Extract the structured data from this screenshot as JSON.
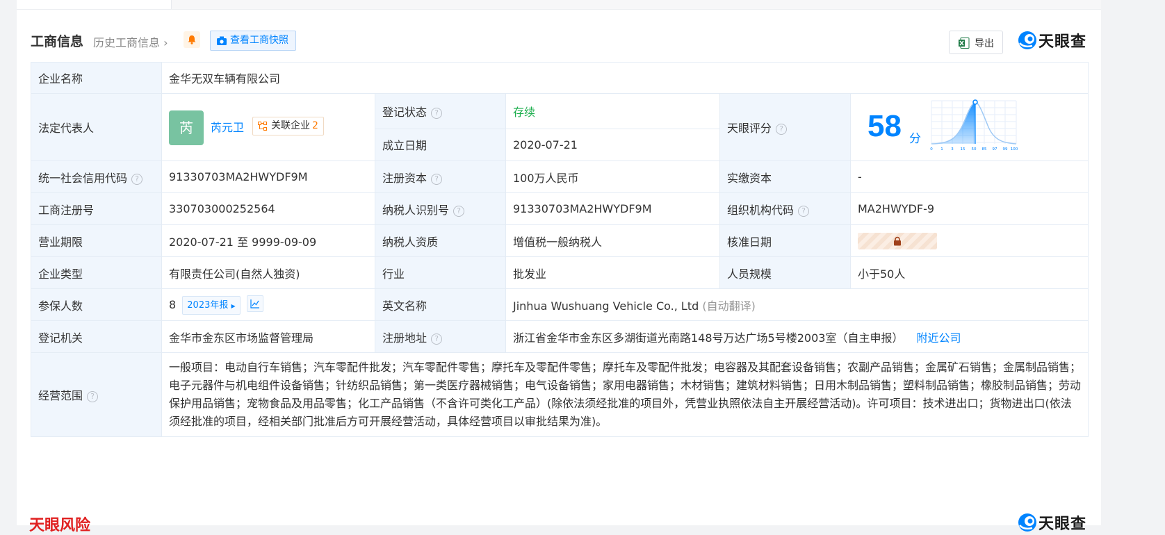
{
  "section": {
    "title": "工商信息",
    "history_link": "历史工商信息",
    "snapshot_button": "查看工商快照",
    "export_button": "导出",
    "brand": "天眼查"
  },
  "colors": {
    "accent": "#0084ff",
    "status_green": "#1cae4d",
    "label_bg": "#f0f6fd",
    "risk_red": "#e02020",
    "badge_orange": "#ff7a00"
  },
  "company": {
    "name_label": "企业名称",
    "name": "金华无双车辆有限公司",
    "legal_rep_label": "法定代表人",
    "legal_rep_avatar": "芮",
    "legal_rep_name": "芮元卫",
    "related_label": "关联企业",
    "related_count": "2",
    "reg_status_label": "登记状态",
    "reg_status": "存续",
    "founded_label": "成立日期",
    "founded": "2020-07-21",
    "score_label": "天眼评分",
    "score": "58",
    "score_unit": "分",
    "score_ticks": [
      "0",
      "1",
      "3",
      "15",
      "50",
      "85",
      "97",
      "99",
      "100"
    ],
    "credit_code_label": "统一社会信用代码",
    "credit_code": "91330703MA2HWYDF9M",
    "reg_capital_label": "注册资本",
    "reg_capital": "100万人民币",
    "paid_capital_label": "实缴资本",
    "paid_capital": "-",
    "reg_no_label": "工商注册号",
    "reg_no": "330703000252564",
    "taxpayer_id_label": "纳税人识别号",
    "taxpayer_id": "91330703MA2HWYDF9M",
    "org_code_label": "组织机构代码",
    "org_code": "MA2HWYDF-9",
    "term_label": "营业期限",
    "term": "2020-07-21 至 9999-09-09",
    "taxpayer_qual_label": "纳税人资质",
    "taxpayer_qual": "增值税一般纳税人",
    "approve_date_label": "核准日期",
    "type_label": "企业类型",
    "type": "有限责任公司(自然人独资)",
    "industry_label": "行业",
    "industry": "批发业",
    "staff_label": "人员规模",
    "staff": "小于50人",
    "insured_label": "参保人数",
    "insured": "8",
    "insured_year": "2023年报",
    "en_name_label": "英文名称",
    "en_name": "Jinhua Wushuang Vehicle Co., Ltd",
    "en_name_note": "(自动翻译)",
    "authority_label": "登记机关",
    "authority": "金华市金东区市场监督管理局",
    "address_label": "注册地址",
    "address": "浙江省金华市金东区多湖街道光南路148号万达广场5号楼2003室（自主申报）",
    "nearby_link": "附近公司",
    "scope_label": "经营范围",
    "scope": "一般项目：电动自行车销售；汽车零配件批发；汽车零配件零售；摩托车及零配件零售；摩托车及零配件批发；电容器及其配套设备销售；农副产品销售；金属矿石销售；金属制品销售；电子元器件与机电组件设备销售；针纺织品销售；第一类医疗器械销售；电气设备销售；家用电器销售；木材销售；建筑材料销售；日用木制品销售；塑料制品销售；橡胶制品销售；劳动保护用品销售；宠物食品及用品零售；化工产品销售（不含许可类化工产品）(除依法须经批准的项目外，凭营业执照依法自主开展经营活动)。许可项目：技术进出口；货物进出口(依法须经批准的项目，经相关部门批准后方可开展经营活动，具体经营项目以审批结果为准)。"
  },
  "next_section": {
    "title": "天眼风险",
    "brand": "天眼查"
  }
}
